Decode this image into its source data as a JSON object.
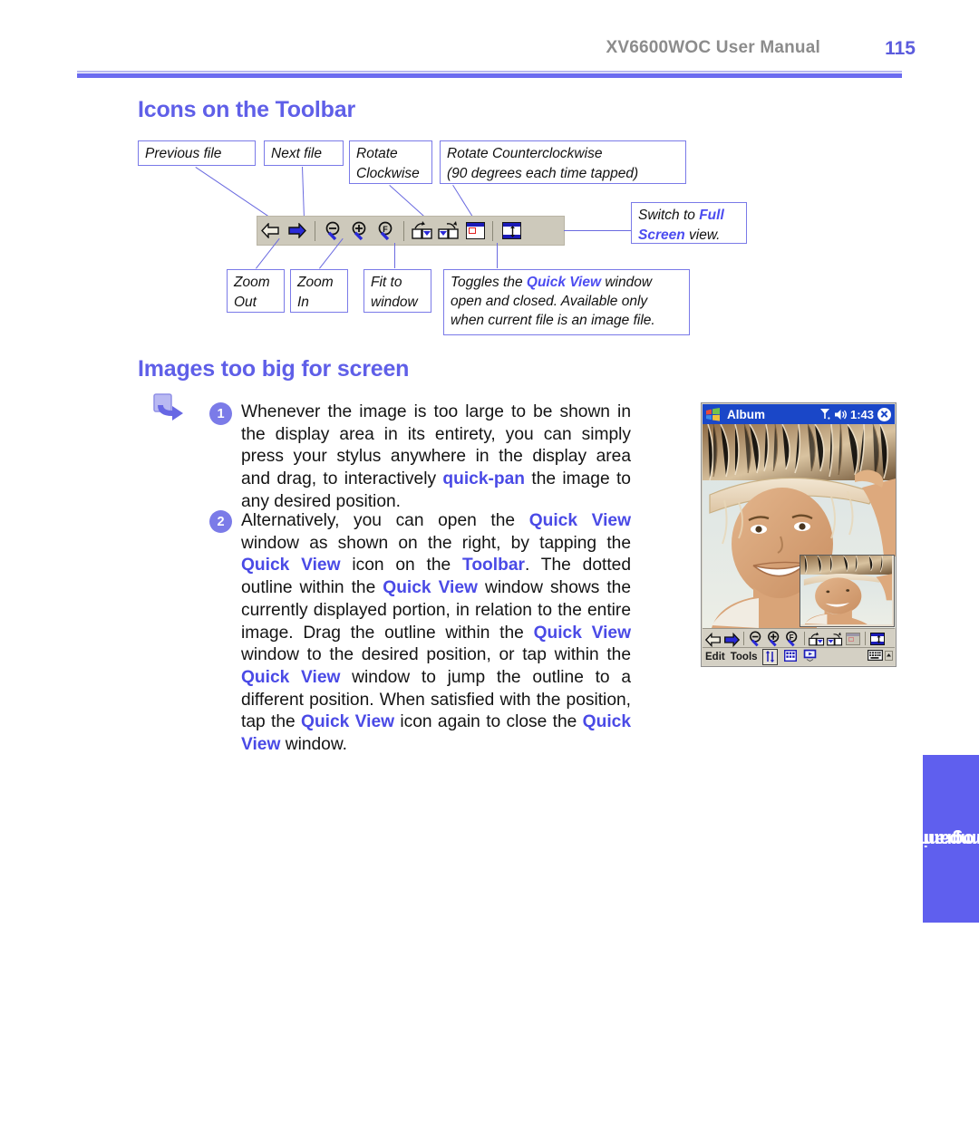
{
  "header": {
    "manual_title": "XV6600WOC User Manual",
    "page_number": "115"
  },
  "sections": {
    "icons_heading": "Icons on the Toolbar",
    "images_heading": "Images too big for screen"
  },
  "toolbar_callouts": {
    "previous_file": "Previous file",
    "next_file": "Next file",
    "rotate_clockwise": "Rotate\nClockwise",
    "rotate_ccw_line1": "Rotate Counterclockwise",
    "rotate_ccw_line2": "(90 degrees each time tapped)",
    "full_screen_pre": "Switch to ",
    "full_screen_bold": "Full Screen",
    "full_screen_post": " view.",
    "zoom_out": "Zoom\nOut",
    "zoom_in": "Zoom\nIn",
    "fit_to_window": "Fit to\nwindow",
    "quick_view_pre": "Toggles the ",
    "quick_view_bold": "Quick View",
    "quick_view_post": " window open and closed. Available only when current file is an image file."
  },
  "toolbar_icons": [
    {
      "name": "previous-file-icon",
      "label": "Previous file"
    },
    {
      "name": "next-file-icon",
      "label": "Next file"
    },
    {
      "name": "zoom-out-icon",
      "label": "Zoom Out"
    },
    {
      "name": "zoom-in-icon",
      "label": "Zoom In"
    },
    {
      "name": "fit-to-window-icon",
      "label": "Fit to window"
    },
    {
      "name": "rotate-clockwise-icon",
      "label": "Rotate Clockwise"
    },
    {
      "name": "rotate-counterclockwise-icon",
      "label": "Rotate Counterclockwise"
    },
    {
      "name": "quick-view-icon",
      "label": "Quick View"
    },
    {
      "name": "full-screen-icon",
      "label": "Full Screen"
    }
  ],
  "steps": {
    "one": {
      "number": "1",
      "text_a": "Whenever the image is too large to be shown in the display area in its entirety, you can simply press your stylus anywhere in the display area and drag, to interactively ",
      "bold_a": "quick-pan",
      "text_b": " the image to any desired position."
    },
    "two": {
      "number": "2",
      "t1": "Alternatively, you can open the ",
      "b1": "Quick View",
      "t2": " window as shown on the right, by tapping the ",
      "b2": "Quick View",
      "t3": " icon on the ",
      "b3": "Toolbar",
      "t4": ".  The dotted outline within the ",
      "b4": "Quick View",
      "t5": " window shows the currently displayed portion, in relation to the entire image. Drag the outline within the ",
      "b5": "Quick View",
      "t6": " window to the desired position, or tap within the ",
      "b6": "Quick View",
      "t7": " window to jump the outline to a different position.  When satisfied with the position, tap the ",
      "b7": "Quick View",
      "t8": " icon again to close the ",
      "b8": "Quick View",
      "t9": " window."
    }
  },
  "pda": {
    "title": "Album",
    "clock": "1:43",
    "menu_edit": "Edit",
    "menu_tools": "Tools",
    "icons": [
      "signal-icon",
      "speaker-icon",
      "close-icon",
      "sort-toggle-icon",
      "grid-icon",
      "slideshow-icon",
      "keyboard-icon"
    ]
  },
  "side_tab": {
    "line1": "Companion",
    "line2": "Programs"
  },
  "colors": {
    "accent_blue": "#5f5fe8",
    "heading_blue": "#5f5fe8",
    "header_gray": "#8c8c8c",
    "toolbar_bg": "#cdc9bb",
    "titlebar_blue": "#1a47c8"
  }
}
